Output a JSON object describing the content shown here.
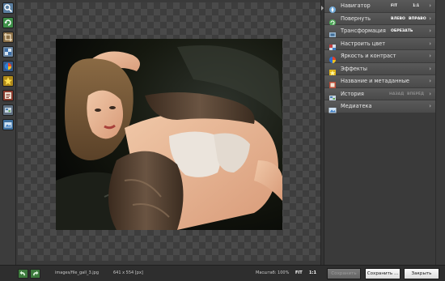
{
  "toolbar": {
    "tools": [
      {
        "icon": "zoom-icon",
        "color": "#5aa0d8"
      },
      {
        "icon": "rotate-icon",
        "color": "#4db35a"
      },
      {
        "icon": "crop-icon",
        "color": "#9a7b4f"
      },
      {
        "icon": "adjust-icon",
        "color": "#7d9ec0"
      },
      {
        "icon": "color-ball-icon",
        "color": "#3c7ed0"
      },
      {
        "icon": "star-effect-icon",
        "color": "#e0c020"
      },
      {
        "icon": "text-icon",
        "color": "#b04a3a"
      },
      {
        "icon": "history-icon",
        "color": "#7a8a9a"
      },
      {
        "icon": "media-icon",
        "color": "#4a8ac0"
      }
    ]
  },
  "panel": {
    "rows": [
      {
        "label": "Навигатор",
        "icon": "navigator-icon",
        "buttons": [
          {
            "text": "FIT",
            "enabled": true
          },
          {
            "text": "1:1",
            "enabled": true
          }
        ]
      },
      {
        "label": "Повернуть",
        "icon": "rotate-icon",
        "buttons": [
          {
            "text": "ВЛЕВО",
            "enabled": true
          },
          {
            "text": "ВПРАВО",
            "enabled": true
          }
        ]
      },
      {
        "label": "Трансформация",
        "icon": "transform-icon",
        "buttons": [
          {
            "text": "ОБРЕЗАТЬ",
            "enabled": true
          }
        ]
      },
      {
        "label": "Настроить цвет",
        "icon": "color-icon",
        "buttons": []
      },
      {
        "label": "Яркость и контраст",
        "icon": "brightness-icon",
        "buttons": []
      },
      {
        "label": "Эффекты",
        "icon": "effects-icon",
        "buttons": []
      },
      {
        "label": "Название и метаданные",
        "icon": "metadata-icon",
        "buttons": []
      },
      {
        "label": "История",
        "icon": "history-icon",
        "buttons": [
          {
            "text": "НАЗАД",
            "enabled": false
          },
          {
            "text": "ВПЕРЁД",
            "enabled": false
          }
        ]
      },
      {
        "label": "Медиатека",
        "icon": "media-library-icon",
        "buttons": []
      }
    ]
  },
  "statusbar": {
    "filename": "images/file_gall_3.jpg",
    "dimensions": "641 x 554 [px]",
    "zoom_label": "Масштаб: 100%",
    "fit_label": "FIT",
    "one_to_one_label": "1:1",
    "save_label": "Сохранить",
    "save_as_label": "Сохранить ...",
    "close_label": "Закрыть"
  }
}
